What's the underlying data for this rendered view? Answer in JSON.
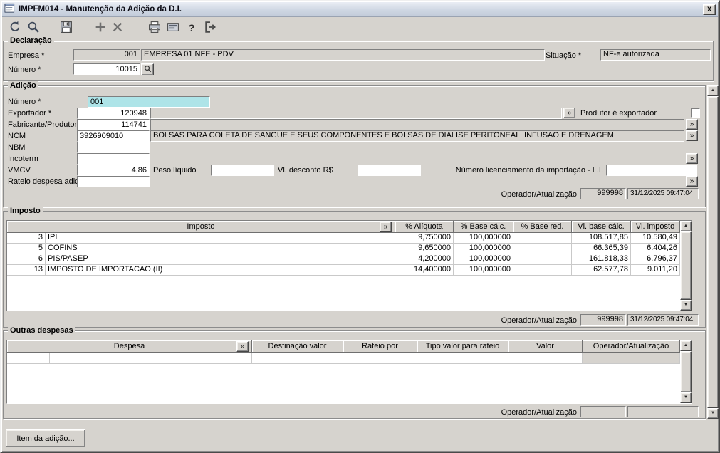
{
  "window": {
    "title": "IMPFM014 - Manutenção da Adição da D.I.",
    "close_label": "X"
  },
  "symbols": {
    "more": "»",
    "up": "▲",
    "down": "▼",
    "help": "?"
  },
  "toolbar": {
    "icons": [
      "undo-icon",
      "search-icon",
      "save-icon",
      "add-icon",
      "delete-icon",
      "print-icon",
      "print-spool-icon",
      "help-icon",
      "exit-icon"
    ]
  },
  "declaracao": {
    "legend": "Declaração",
    "empresa_label": "Empresa *",
    "empresa_code": "001",
    "empresa_name": "EMPRESA 01 NFE - PDV",
    "situacao_label": "Situação *",
    "situacao_value": "NF-e autorizada",
    "numero_label": "Número *",
    "numero_value": "10015"
  },
  "adicao": {
    "legend": "Adição",
    "numero_label": "Número *",
    "numero_value": "001",
    "exportador_label": "Exportador *",
    "exportador_code": "120948",
    "produtor_checkbox_label": "Produtor é exportador",
    "fabricante_label": "Fabricante/Produtor",
    "fabricante_code": "114741",
    "ncm_label": "NCM",
    "ncm_code": "3926909010",
    "ncm_descricao": "BOLSAS PARA COLETA DE SANGUE E SEUS COMPONENTES E BOLSAS DE DIALISE PERITONEAL  INFUSAO E DRENAGEM",
    "nbm_label": "NBM",
    "incoterm_label": "Incoterm",
    "vmcv_label": "VMCV",
    "vmcv_value": "4,86",
    "peso_liquido_label": "Peso líquido",
    "vl_desconto_label": "Vl. desconto R$",
    "licenciamento_label": "Número licenciamento da importação - L.I.",
    "rateio_label": "Rateio despesa adic.",
    "operador_label": "Operador/Atualização",
    "operador_value": "999998",
    "atualizacao_value": "31/12/2025 09:47:04"
  },
  "imposto": {
    "legend": "Imposto",
    "columns": [
      "Imposto",
      "% Alíquota",
      "% Base cálc.",
      "% Base red.",
      "Vl. base cálc.",
      "Vl. imposto"
    ],
    "rows": [
      {
        "codigo": "3",
        "nome": "IPI",
        "aliquota": "9,750000",
        "base_calc": "100,000000",
        "base_red": "",
        "vl_base": "108.517,85",
        "vl_imposto": "10.580,49"
      },
      {
        "codigo": "5",
        "nome": "COFINS",
        "aliquota": "9,650000",
        "base_calc": "100,000000",
        "base_red": "",
        "vl_base": "66.365,39",
        "vl_imposto": "6.404,26"
      },
      {
        "codigo": "6",
        "nome": "PIS/PASEP",
        "aliquota": "4,200000",
        "base_calc": "100,000000",
        "base_red": "",
        "vl_base": "161.818,33",
        "vl_imposto": "6.796,37"
      },
      {
        "codigo": "13",
        "nome": "IMPOSTO DE IMPORTACAO (II)",
        "aliquota": "14,400000",
        "base_calc": "100,000000",
        "base_red": "",
        "vl_base": "62.577,78",
        "vl_imposto": "9.011,20"
      }
    ],
    "operador_label": "Operador/Atualização",
    "operador_value": "999998",
    "atualizacao_value": "31/12/2025 09:47:04"
  },
  "outras_despesas": {
    "legend": "Outras despesas",
    "columns": [
      "Despesa",
      "Destinação valor",
      "Rateio por",
      "Tipo valor para rateio",
      "Valor",
      "Operador/Atualização"
    ],
    "operador_label": "Operador/Atualização"
  },
  "footer": {
    "item_button_mnemonic": "I",
    "item_button_rest": "tem da adição..."
  }
}
